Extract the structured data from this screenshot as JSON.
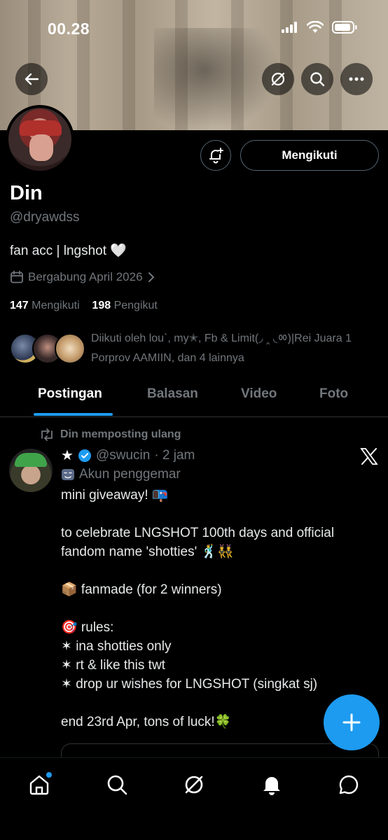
{
  "status_bar": {
    "time": "00.28"
  },
  "profile": {
    "name": "Din",
    "handle": "@dryawdss",
    "bio": "fan acc | lngshot 🤍",
    "joined": "Bergabung April 2026",
    "following_count": "147",
    "following_label": "Mengikuti",
    "followers_count": "198",
    "followers_label": "Pengikut",
    "followed_by": "Diikuti oleh lou`, my✭, Fb & Limit(◞ ‸ ◟ㆀ)|Rei Juara 1 Porprov AAMIIN, dan 4 lainnya",
    "follow_button": "Mengikuti"
  },
  "tabs": [
    {
      "label": "Postingan"
    },
    {
      "label": "Balasan"
    },
    {
      "label": "Video"
    },
    {
      "label": "Foto"
    }
  ],
  "post": {
    "repost_label": "Din memposting ulang",
    "author_name": "★",
    "author_handle": "@swucin",
    "time": "· 2 jam",
    "fan_label": "Akun penggemar",
    "body": "mini giveaway! 📭\n\nto celebrate LNGSHOT 100th days and official fandom name 'shotties' 🕺👯‍♂️\n\n📦 fanmade (for 2 winners)\n\n🎯 rules:\n✶ ina shotties only\n✶ rt & like this twt\n✶ drop ur wishes for LNGSHOT (singkat sj)\n\nend 23rd Apr, tons of luck!🍀"
  },
  "colors": {
    "accent": "#1d9bf0",
    "muted": "#71767b",
    "border": "#2f3336"
  },
  "icons": [
    "back-arrow-icon",
    "grok-icon",
    "search-icon",
    "more-icon",
    "notification-add-icon",
    "calendar-icon",
    "chevron-right-icon",
    "repost-icon",
    "verified-badge-icon",
    "x-logo-icon",
    "mask-icon",
    "plus-icon",
    "home-icon",
    "notifications-icon",
    "messages-icon"
  ]
}
